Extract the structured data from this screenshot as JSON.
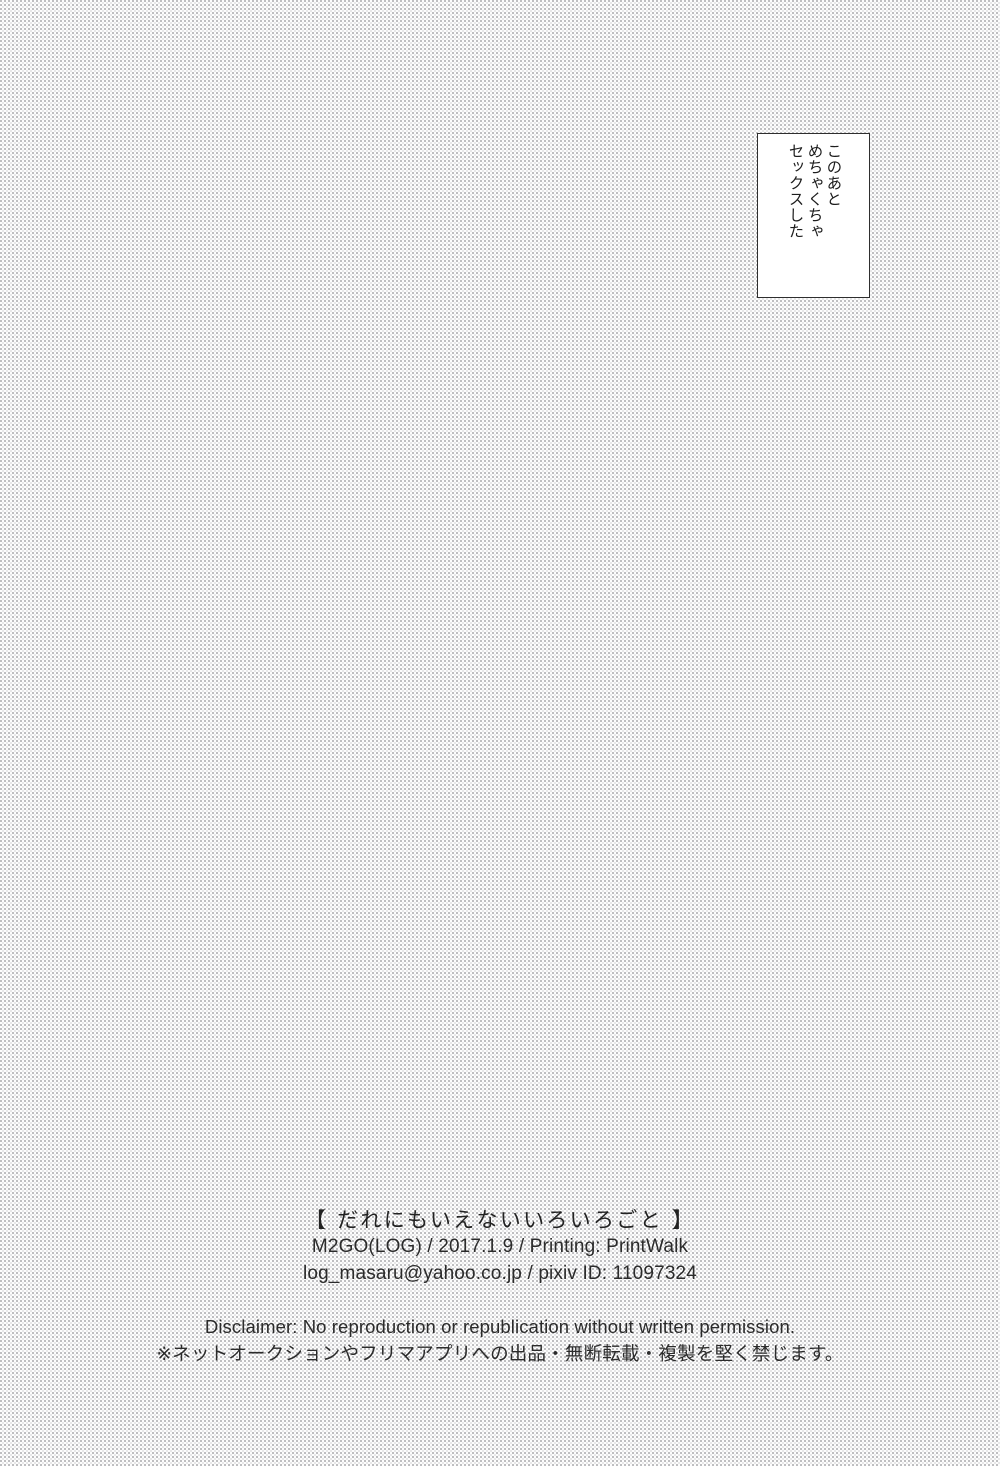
{
  "page": {
    "background_color": "#fdfdfd",
    "tone_dot_color": "#78787d",
    "text_color": "#2b2b2b"
  },
  "caption_box": {
    "border_color": "#2e2e2e",
    "fill_color": "#ffffff",
    "reading_order": "vertical right-to-left",
    "columns": [
      "このあと",
      "めちゃくちゃ",
      "セックスした"
    ],
    "full_text": "このあとめちゃくちゃセックスした"
  },
  "colophon": {
    "title": "【 だれにもいえないいろいろごと 】",
    "credit_line": "M2GO(LOG) / 2017.1.9 / Printing: PrintWalk",
    "contact_line": "log_masaru@yahoo.co.jp / pixiv ID: 11097324",
    "circle": "M2GO(LOG)",
    "date": "2017.1.9",
    "printer": "PrintWalk",
    "email": "log_masaru@yahoo.co.jp",
    "pixiv_id": "11097324"
  },
  "disclaimer": {
    "english": "Disclaimer: No reproduction or republication without written permission.",
    "japanese": "※ネットオークションやフリマアプリへの出品・無断転載・複製を堅く禁じます。"
  }
}
